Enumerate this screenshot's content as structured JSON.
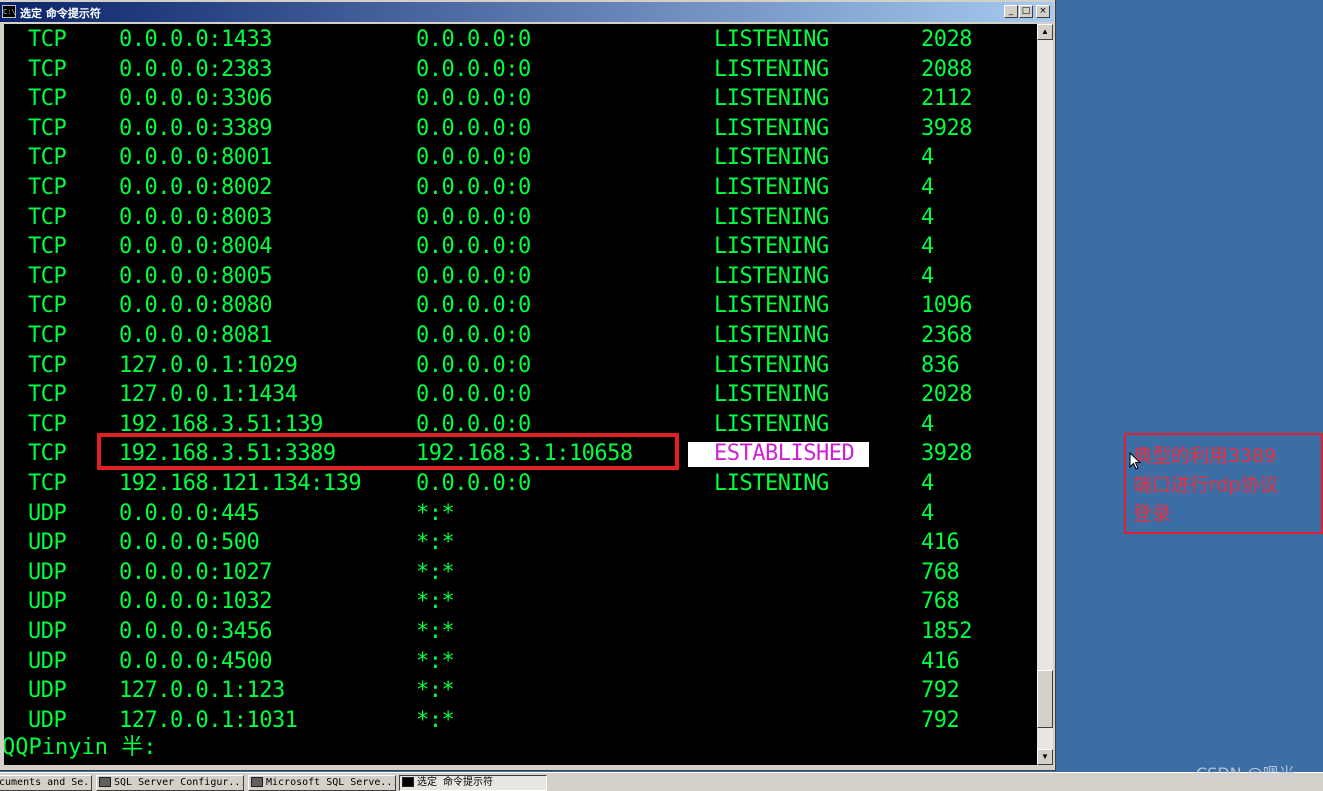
{
  "window": {
    "icon_text": "C:\\",
    "title": "选定 命令提示符",
    "minimize_label": "_",
    "maximize_label": "□",
    "close_label": "×"
  },
  "rows": [
    {
      "proto": "TCP",
      "local": "0.0.0.0:1433",
      "foreign": "0.0.0.0:0",
      "state": "LISTENING",
      "pid": "2028"
    },
    {
      "proto": "TCP",
      "local": "0.0.0.0:2383",
      "foreign": "0.0.0.0:0",
      "state": "LISTENING",
      "pid": "2088"
    },
    {
      "proto": "TCP",
      "local": "0.0.0.0:3306",
      "foreign": "0.0.0.0:0",
      "state": "LISTENING",
      "pid": "2112"
    },
    {
      "proto": "TCP",
      "local": "0.0.0.0:3389",
      "foreign": "0.0.0.0:0",
      "state": "LISTENING",
      "pid": "3928"
    },
    {
      "proto": "TCP",
      "local": "0.0.0.0:8001",
      "foreign": "0.0.0.0:0",
      "state": "LISTENING",
      "pid": "4"
    },
    {
      "proto": "TCP",
      "local": "0.0.0.0:8002",
      "foreign": "0.0.0.0:0",
      "state": "LISTENING",
      "pid": "4"
    },
    {
      "proto": "TCP",
      "local": "0.0.0.0:8003",
      "foreign": "0.0.0.0:0",
      "state": "LISTENING",
      "pid": "4"
    },
    {
      "proto": "TCP",
      "local": "0.0.0.0:8004",
      "foreign": "0.0.0.0:0",
      "state": "LISTENING",
      "pid": "4"
    },
    {
      "proto": "TCP",
      "local": "0.0.0.0:8005",
      "foreign": "0.0.0.0:0",
      "state": "LISTENING",
      "pid": "4"
    },
    {
      "proto": "TCP",
      "local": "0.0.0.0:8080",
      "foreign": "0.0.0.0:0",
      "state": "LISTENING",
      "pid": "1096"
    },
    {
      "proto": "TCP",
      "local": "0.0.0.0:8081",
      "foreign": "0.0.0.0:0",
      "state": "LISTENING",
      "pid": "2368"
    },
    {
      "proto": "TCP",
      "local": "127.0.0.1:1029",
      "foreign": "0.0.0.0:0",
      "state": "LISTENING",
      "pid": "836"
    },
    {
      "proto": "TCP",
      "local": "127.0.0.1:1434",
      "foreign": "0.0.0.0:0",
      "state": "LISTENING",
      "pid": "2028"
    },
    {
      "proto": "TCP",
      "local": "192.168.3.51:139",
      "foreign": "0.0.0.0:0",
      "state": "LISTENING",
      "pid": "4"
    },
    {
      "proto": "TCP",
      "local": "192.168.3.51:3389",
      "foreign": "192.168.3.1:10658",
      "state": "ESTABLISHED",
      "pid": "3928"
    },
    {
      "proto": "TCP",
      "local": "192.168.121.134:139",
      "foreign": "0.0.0.0:0",
      "state": "LISTENING",
      "pid": "4"
    },
    {
      "proto": "UDP",
      "local": "0.0.0.0:445",
      "foreign": "*:*",
      "state": "",
      "pid": "4"
    },
    {
      "proto": "UDP",
      "local": "0.0.0.0:500",
      "foreign": "*:*",
      "state": "",
      "pid": "416"
    },
    {
      "proto": "UDP",
      "local": "0.0.0.0:1027",
      "foreign": "*:*",
      "state": "",
      "pid": "768"
    },
    {
      "proto": "UDP",
      "local": "0.0.0.0:1032",
      "foreign": "*:*",
      "state": "",
      "pid": "768"
    },
    {
      "proto": "UDP",
      "local": "0.0.0.0:3456",
      "foreign": "*:*",
      "state": "",
      "pid": "1852"
    },
    {
      "proto": "UDP",
      "local": "0.0.0.0:4500",
      "foreign": "*:*",
      "state": "",
      "pid": "416"
    },
    {
      "proto": "UDP",
      "local": "127.0.0.1:123",
      "foreign": "*:*",
      "state": "",
      "pid": "792"
    },
    {
      "proto": "UDP",
      "local": "127.0.0.1:1031",
      "foreign": "*:*",
      "state": "",
      "pid": "792"
    }
  ],
  "prompt": "QQPinyin 半:",
  "annotation": {
    "lines": [
      "典型的利用3389",
      "端口进行rdp协议",
      "登录"
    ]
  },
  "taskbar": {
    "items": [
      {
        "label": "cuments and Se...",
        "active": false
      },
      {
        "label": "SQL Server Configur...",
        "active": false
      },
      {
        "label": "Microsoft SQL Serve...",
        "active": false
      },
      {
        "label": "选定 命令提示符",
        "active": true
      }
    ]
  },
  "watermark": "CSDN @嗯光",
  "colors": {
    "console_text": "#00ff40",
    "established_text": "#d020d0",
    "highlight_border": "#e02020",
    "annotation_text": "#e83040",
    "desktop": "#3a6ea5"
  }
}
